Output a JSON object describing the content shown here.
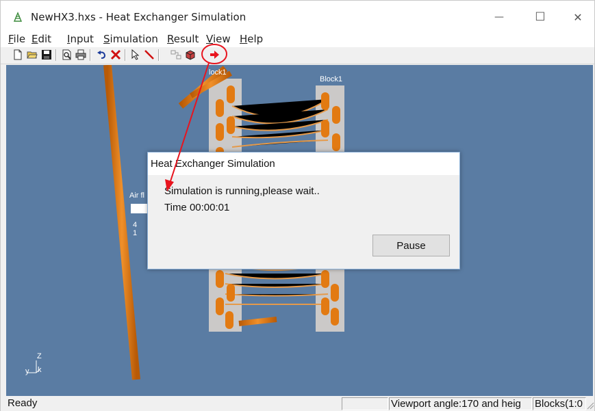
{
  "window": {
    "title": "NewHX3.hxs - Heat Exchanger Simulation",
    "minimize_glyph": "—",
    "maximize_glyph": "☐",
    "close_glyph": "✕"
  },
  "menu": {
    "file": {
      "first": "F",
      "rest": "ile"
    },
    "edit": {
      "first": "E",
      "rest": "dit"
    },
    "input": {
      "first": "I",
      "rest": "nput"
    },
    "simulation": {
      "first": "S",
      "rest": "imulation"
    },
    "result": {
      "first": "R",
      "rest": "esult"
    },
    "view": {
      "first": "V",
      "rest": "iew"
    },
    "help": {
      "first": "H",
      "rest": "elp"
    }
  },
  "toolbar": {
    "icons": [
      "new-file-icon",
      "open-folder-icon",
      "save-icon",
      "print-preview-icon",
      "print-icon",
      "undo-icon",
      "delete-icon",
      "select-pointer-icon",
      "draw-pipe-icon",
      "connect-icon",
      "block-icon",
      "run-simulation-icon"
    ],
    "highlight_color": "#e8141e"
  },
  "viewport": {
    "background": "#5a7ca3",
    "labels": {
      "block_left": "lock1",
      "block_right": "Block1",
      "air_flow": "Air fl",
      "num_a": "4",
      "num_b": "1"
    },
    "axis": {
      "z": "Z",
      "y": "y",
      "x": "k"
    },
    "tube_color": "#e27a12"
  },
  "dialog": {
    "title": "Heat Exchanger Simulation",
    "message": "Simulation is running,please wait..",
    "time": "Time 00:00:01",
    "pause_label": "Pause"
  },
  "status": {
    "ready": "Ready",
    "viewport_angle": "Viewport angle:170 and heig",
    "blocks": "Blocks(1:0"
  }
}
